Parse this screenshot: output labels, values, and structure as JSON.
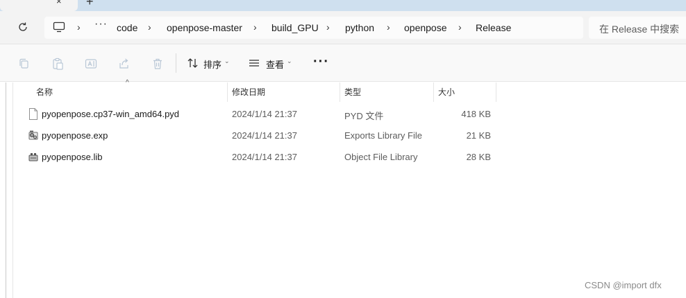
{
  "tab": {
    "close_glyph": "×",
    "new_glyph": "+"
  },
  "breadcrumb": {
    "more": "···",
    "items": [
      "code",
      "openpose-master",
      "build_GPU",
      "python",
      "openpose",
      "Release"
    ],
    "separator": "›"
  },
  "search": {
    "placeholder": "在 Release 中搜索"
  },
  "toolbar": {
    "sort_label": "排序",
    "view_label": "查看",
    "more_label": "···",
    "icons": [
      "copy-icon",
      "paste-icon",
      "rename-icon",
      "share-icon",
      "delete-icon"
    ]
  },
  "columns": {
    "name": "名称",
    "date": "修改日期",
    "type": "类型",
    "size": "大小"
  },
  "files": [
    {
      "name": "pyopenpose.cp37-win_amd64.pyd",
      "date": "2024/1/14 21:37",
      "type": "PYD 文件",
      "size": "418 KB",
      "icon": "file-icon"
    },
    {
      "name": "pyopenpose.exp",
      "date": "2024/1/14 21:37",
      "type": "Exports Library File",
      "size": "21 KB",
      "icon": "exp-file-icon"
    },
    {
      "name": "pyopenpose.lib",
      "date": "2024/1/14 21:37",
      "type": "Object File Library",
      "size": "28 KB",
      "icon": "lib-file-icon"
    }
  ],
  "watermark": "CSDN @import dfx"
}
